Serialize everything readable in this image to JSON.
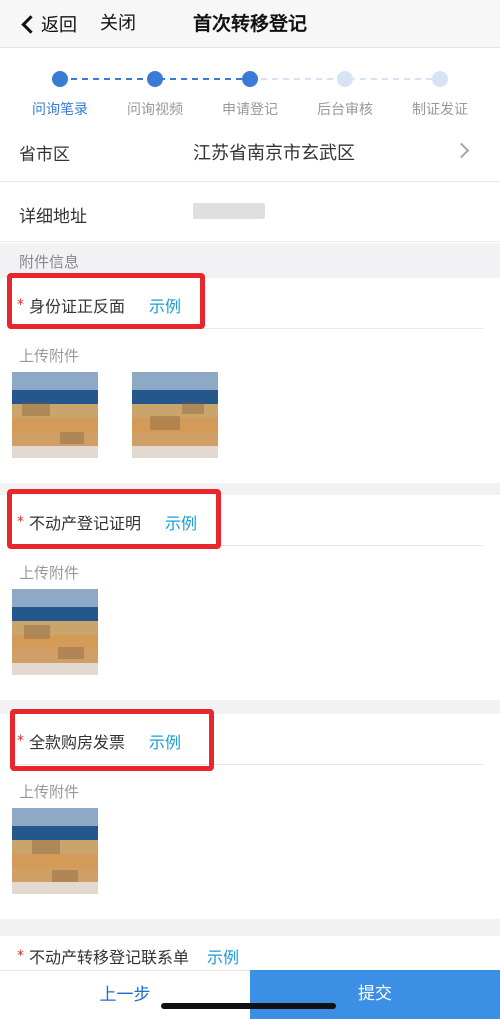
{
  "nav": {
    "back_label": "返回",
    "close_label": "关闭",
    "title": "首次转移登记"
  },
  "steps": {
    "items": [
      {
        "label": "问询笔录",
        "active": true
      },
      {
        "label": "问询视频",
        "active": true
      },
      {
        "label": "申请登记",
        "active": true
      },
      {
        "label": "后台审核",
        "active": false
      },
      {
        "label": "制证发证",
        "active": false
      }
    ],
    "active_color": "#3a7bd5",
    "inactive_color": "#d6e3f5"
  },
  "form": {
    "province_label": "省市区",
    "province_value": "江苏省南京市玄武区",
    "address_label": "详细地址"
  },
  "attachments": {
    "section_title": "附件信息",
    "required_mark": "*",
    "upload_label": "上传附件",
    "example_label": "示例",
    "items": [
      {
        "title": "身份证正反面"
      },
      {
        "title": "不动产登记证明"
      },
      {
        "title": "全款购房发票"
      },
      {
        "title": "不动产转移登记联系单"
      }
    ]
  },
  "footer": {
    "prev_label": "上一步",
    "submit_label": "提交"
  },
  "colors": {
    "link": "#1a9bd7",
    "required": "#e02b2b",
    "highlight": "#e8262b",
    "submit_bg": "#3b8fe5"
  }
}
